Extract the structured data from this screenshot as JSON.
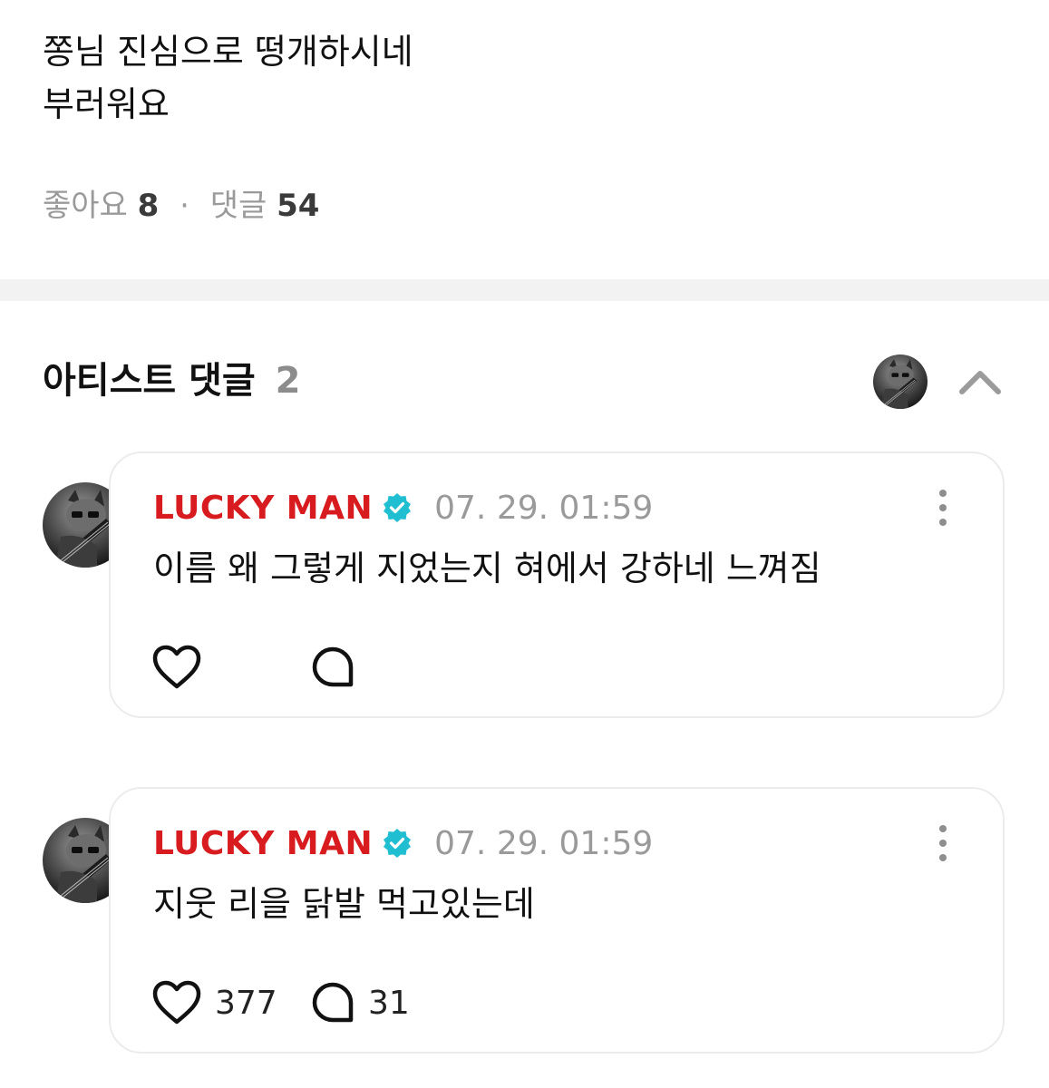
{
  "post": {
    "body_line1": "쫑님 진심으로 떵개하시네",
    "body_line2": "부러워요",
    "likes_label": "좋아요",
    "likes_count": "8",
    "separator": "·",
    "comments_label": "댓글",
    "comments_count": "54"
  },
  "artist_section": {
    "title": "아티스트 댓글",
    "count": "2",
    "collapse_icon": "chevron-up-icon"
  },
  "comments": [
    {
      "author": "LUCKY MAN",
      "verified_icon": "verified-badge-icon",
      "time": "07. 29. 01:59",
      "text": "이름 왜 그렇게 지었는지 혀에서 강하네 느껴짐",
      "like_count": "",
      "reply_count": ""
    },
    {
      "author": "LUCKY MAN",
      "verified_icon": "verified-badge-icon",
      "time": "07. 29. 01:59",
      "text": "지웃 리을 닭발 먹고있는데",
      "like_count": "377",
      "reply_count": "31"
    }
  ],
  "colors": {
    "author": "#d81b1f",
    "verified": "#1fbfd1",
    "muted": "#9a9a9a",
    "divider": "#f2f2f2",
    "card_border": "#ececec"
  }
}
